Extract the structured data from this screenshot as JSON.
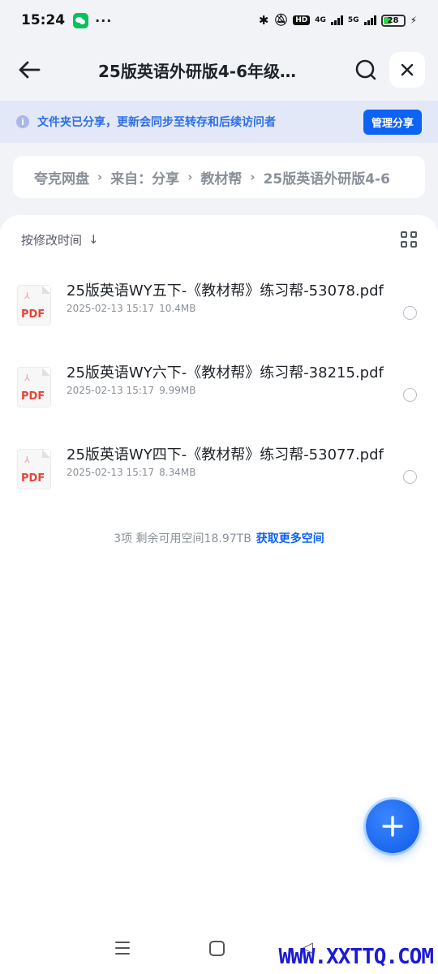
{
  "status_bar": {
    "time": "15:24",
    "more": "···",
    "hd": "HD",
    "net1": "4G",
    "net2": "5G",
    "battery": "28"
  },
  "header": {
    "title": "25版英语外研版4-6年级…"
  },
  "notice": {
    "text": "文件夹已分享，更新会同步至转存和后续访问者",
    "manage_label": "管理分享"
  },
  "breadcrumb": {
    "items": [
      "夸克网盘",
      "来自：分享",
      "教材帮",
      "25版英语外研版4-6"
    ]
  },
  "sort": {
    "label": "按修改时间"
  },
  "files": [
    {
      "name": "25版英语WY五下-《教材帮》练习帮-53078.pdf",
      "date": "2025-02-13 15:17",
      "size": "10.4MB",
      "type": "PDF"
    },
    {
      "name": "25版英语WY六下-《教材帮》练习帮-38215.pdf",
      "date": "2025-02-13 15:17",
      "size": "9.99MB",
      "type": "PDF"
    },
    {
      "name": "25版英语WY四下-《教材帮》练习帮-53077.pdf",
      "date": "2025-02-13 15:17",
      "size": "8.34MB",
      "type": "PDF"
    }
  ],
  "summary": {
    "text": "3项 剩余可用空间18.97TB",
    "link": "获取更多空间"
  },
  "watermark": "WWW.XXTTQ.COM",
  "colors": {
    "accent": "#0d63f3",
    "notice_bg": "#e3e8f8",
    "pdf_red": "#e8443a"
  }
}
